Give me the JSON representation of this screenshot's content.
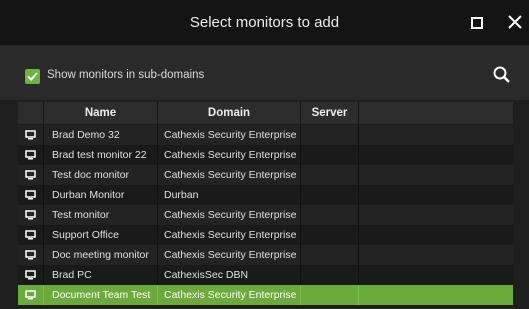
{
  "window": {
    "title": "Select monitors to add"
  },
  "options": {
    "show_subdomains_label": "Show monitors in sub-domains",
    "show_subdomains_checked": true
  },
  "table": {
    "columns": [
      "",
      "Name",
      "Domain",
      "Server"
    ],
    "rows": [
      {
        "name": "Brad Demo 32",
        "domain": "Cathexis Security Enterprise",
        "server": ""
      },
      {
        "name": "Brad test monitor 22",
        "domain": "Cathexis Security Enterprise",
        "server": ""
      },
      {
        "name": "Test doc monitor",
        "domain": "Cathexis Security Enterprise",
        "server": ""
      },
      {
        "name": "Durban Monitor",
        "domain": "Durban",
        "server": ""
      },
      {
        "name": "Test monitor",
        "domain": "Cathexis Security Enterprise",
        "server": ""
      },
      {
        "name": "Support Office",
        "domain": "Cathexis Security Enterprise",
        "server": ""
      },
      {
        "name": "Doc meeting monitor",
        "domain": "Cathexis Security Enterprise",
        "server": ""
      },
      {
        "name": "Brad PC",
        "domain": "CathexisSec DBN",
        "server": ""
      },
      {
        "name": "Document Team Test",
        "domain": "Cathexis Security Enterprise",
        "server": ""
      }
    ],
    "selected_row": 8
  },
  "icons": {
    "row_icon": "monitor-icon",
    "search": "search-icon",
    "close": "close-icon",
    "maximize": "maximize-icon",
    "check": "check-icon"
  },
  "colors": {
    "accent": "#6aab3c",
    "title_bar": "#141414",
    "background": "#1f1f1f"
  }
}
